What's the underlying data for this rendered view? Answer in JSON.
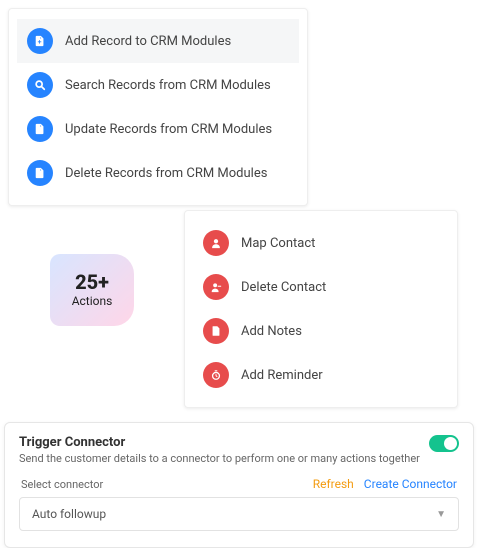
{
  "crm_actions": [
    {
      "label": "Add Record to CRM Modules",
      "icon": "file-plus",
      "highlighted": true
    },
    {
      "label": "Search Records from CRM Modules",
      "icon": "search",
      "highlighted": false
    },
    {
      "label": "Update Records from CRM Modules",
      "icon": "file-edit",
      "highlighted": false
    },
    {
      "label": "Delete Records from CRM Modules",
      "icon": "file-minus",
      "highlighted": false
    }
  ],
  "actions_badge": {
    "count_label": "25+",
    "subtitle": "Actions"
  },
  "contact_actions": [
    {
      "label": "Map Contact",
      "icon": "user"
    },
    {
      "label": "Delete Contact",
      "icon": "user-minus"
    },
    {
      "label": "Add Notes",
      "icon": "file"
    },
    {
      "label": "Add Reminder",
      "icon": "clock"
    }
  ],
  "trigger": {
    "title": "Trigger Connector",
    "description": "Send the customer details to a connector to perform one or many actions together",
    "enabled": true,
    "select_label": "Select connector",
    "refresh_label": "Refresh",
    "create_label": "Create Connector",
    "selected_value": "Auto followup"
  }
}
